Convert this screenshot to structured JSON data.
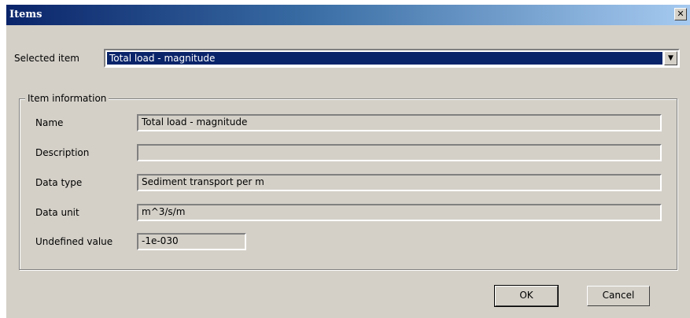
{
  "window": {
    "title": "Items",
    "close_glyph": "✕"
  },
  "selected": {
    "label": "Selected item",
    "value": "Total load - magnitude",
    "dropdown_glyph": "▼"
  },
  "info": {
    "legend": "Item information",
    "name_label": "Name",
    "name_value": "Total load - magnitude",
    "description_label": "Description",
    "description_value": "",
    "datatype_label": "Data type",
    "datatype_value": "Sediment transport per m",
    "dataunit_label": "Data unit",
    "dataunit_value": "m^3/s/m",
    "undefined_label": "Undefined value",
    "undefined_value": "-1e-030"
  },
  "buttons": {
    "ok": "OK",
    "cancel": "Cancel"
  }
}
